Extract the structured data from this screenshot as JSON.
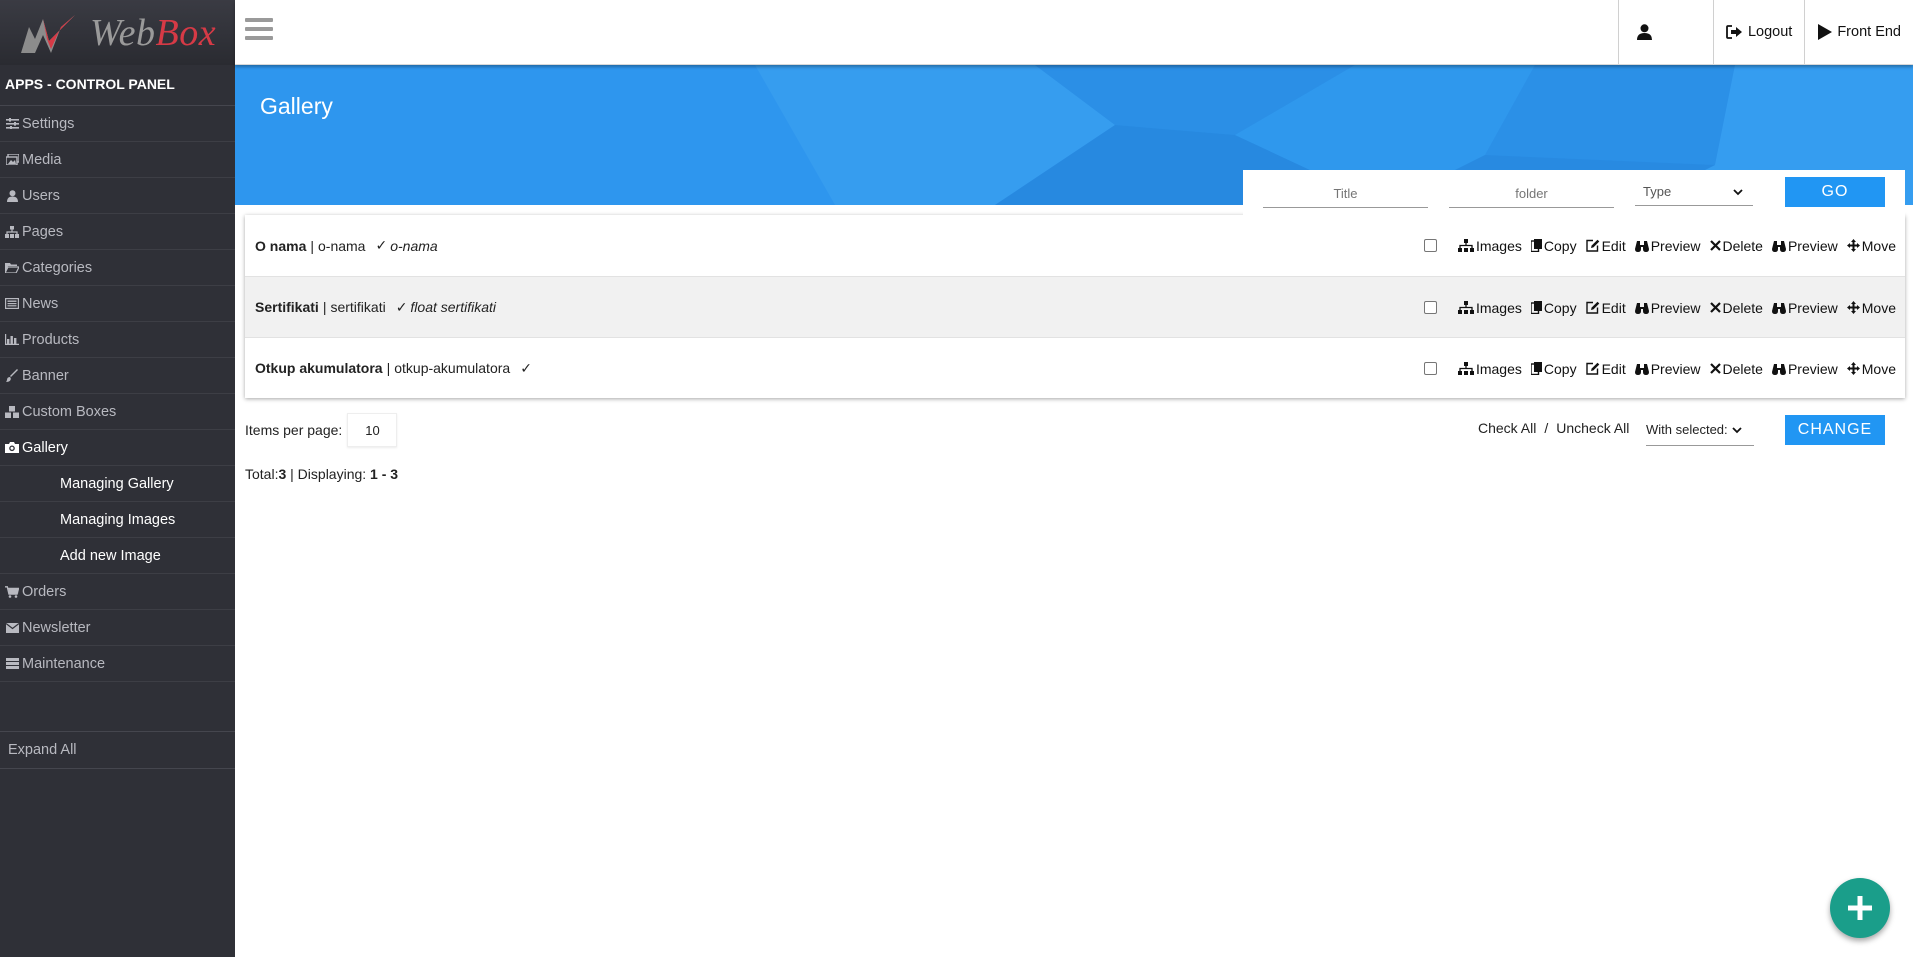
{
  "brand": {
    "logo_text_a": "Web",
    "logo_text_b": "Box",
    "panel_title": "APPS - CONTROL PANEL"
  },
  "sidebar": {
    "items": [
      {
        "label": "Settings",
        "icon": "sliders-icon"
      },
      {
        "label": "Media",
        "icon": "images-icon"
      },
      {
        "label": "Users",
        "icon": "user-icon"
      },
      {
        "label": "Pages",
        "icon": "sitemap-icon"
      },
      {
        "label": "Categories",
        "icon": "folder-open-icon"
      },
      {
        "label": "News",
        "icon": "newspaper-icon"
      },
      {
        "label": "Products",
        "icon": "chart-icon"
      },
      {
        "label": "Banner",
        "icon": "brush-icon"
      },
      {
        "label": "Custom Boxes",
        "icon": "cubes-icon"
      },
      {
        "label": "Gallery",
        "icon": "camera-icon"
      }
    ],
    "gallery_sub": [
      "Managing Gallery",
      "Managing Images",
      "Add new Image"
    ],
    "items_after": [
      {
        "label": "Orders",
        "icon": "cart-icon"
      },
      {
        "label": "Newsletter",
        "icon": "envelope-icon"
      },
      {
        "label": "Maintenance",
        "icon": "server-icon"
      }
    ],
    "expand_all": "Expand All"
  },
  "topbar": {
    "logout": "Logout",
    "front_end": "Front End"
  },
  "page": {
    "title": "Gallery"
  },
  "filter": {
    "title_placeholder": "Title",
    "folder_placeholder": "folder",
    "type_value": "Type",
    "go": "GO"
  },
  "rows": [
    {
      "name": "O nama",
      "slug": "o-nama",
      "check": "✓",
      "desc": "o-nama"
    },
    {
      "name": "Sertifikati",
      "slug": "sertifikati",
      "check": "✓",
      "desc": "float sertifikati"
    },
    {
      "name": "Otkup akumulatora",
      "slug": "otkup-akumulatora",
      "check": "✓",
      "desc": ""
    }
  ],
  "row_actions": {
    "images": "Images",
    "copy": "Copy",
    "edit": "Edit",
    "preview": "Preview",
    "delete": "Delete",
    "preview2": "Preview",
    "move": "Move"
  },
  "pager": {
    "items_per_page_label": "Items per page:",
    "items_per_page": "10",
    "check_all": "Check All",
    "slash": "/",
    "uncheck_all": "Uncheck All",
    "with_selected": "With selected:",
    "change": "CHANGE",
    "total_label": "Total:",
    "total": "3",
    "displaying_label": " | Displaying: ",
    "displaying": "1 - 3"
  },
  "colors": {
    "accent": "#2196f3",
    "banner": "#2e96ee",
    "sidebar": "#2f3037",
    "fab": "#1a9e8a",
    "logo_red": "#d63a46"
  }
}
